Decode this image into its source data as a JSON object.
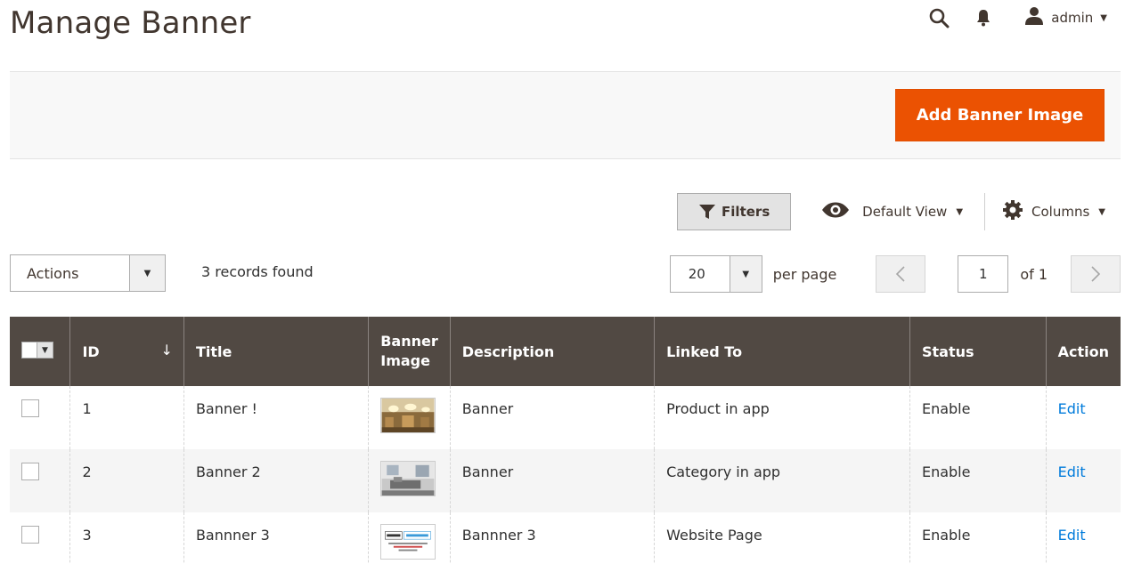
{
  "header": {
    "page_title": "Manage Banner",
    "user": "admin"
  },
  "action_bar": {
    "add_button_label": "Add Banner Image",
    "accent_color": "#eb5202"
  },
  "grid_controls": {
    "filters_label": "Filters",
    "view_label": "Default View",
    "columns_label": "Columns"
  },
  "toolbar": {
    "actions_label": "Actions",
    "records_found": "3 records found",
    "per_page_value": "20",
    "per_page_label": "per page",
    "current_page": "1",
    "of_pages": "of 1"
  },
  "table": {
    "headers": {
      "id": "ID",
      "sort_indicator": "↓",
      "title": "Title",
      "banner_image": "Banner Image",
      "description": "Description",
      "linked_to": "Linked To",
      "status": "Status",
      "action": "Action"
    },
    "rows": [
      {
        "id": "1",
        "title": "Banner !",
        "description": "Banner",
        "linked_to": "Product in app",
        "status": "Enable",
        "action": "Edit",
        "image": "hotel-lobby-thumbnail"
      },
      {
        "id": "2",
        "title": "Banner 2",
        "description": "Banner",
        "linked_to": "Category in app",
        "status": "Enable",
        "action": "Edit",
        "image": "interior-room-thumbnail"
      },
      {
        "id": "3",
        "title": "Bannner 3",
        "description": "Bannner 3",
        "linked_to": "Website Page",
        "status": "Enable",
        "action": "Edit",
        "image": "coming-soon-thumbnail"
      }
    ],
    "header_color": "#514943",
    "link_color": "#007bdb"
  }
}
